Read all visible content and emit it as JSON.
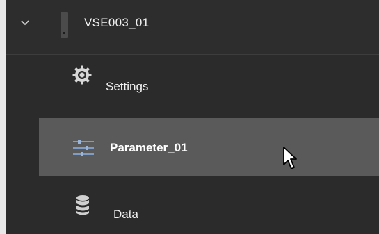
{
  "tree": {
    "device": {
      "label": "VSE003_01",
      "expand_icon": "chevron-down-icon",
      "icon": "device-module-icon"
    },
    "children": [
      {
        "label": "Settings",
        "icon": "gear-icon"
      },
      {
        "label": "Parameter_01",
        "icon": "sliders-icon",
        "selected": true
      },
      {
        "label": "Data",
        "icon": "database-icon"
      }
    ]
  },
  "colors": {
    "panel_bg": "#2b2b2b",
    "selected_bg": "#5a5a5a",
    "text": "#f2f2f2",
    "icon_accent": "#6f8fb8"
  }
}
